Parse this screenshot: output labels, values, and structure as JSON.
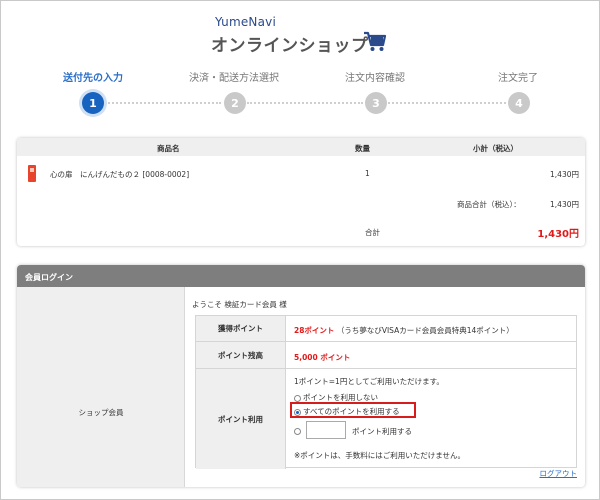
{
  "logo": {
    "top_text": "YumeNavi",
    "main_text": "オンラインショップ"
  },
  "steps": [
    {
      "number": "1",
      "label": "送付先の入力"
    },
    {
      "number": "2",
      "label": "決済・配送方法選択"
    },
    {
      "number": "3",
      "label": "注文内容確認"
    },
    {
      "number": "4",
      "label": "注文完了"
    }
  ],
  "cart": {
    "headers": {
      "product": "商品名",
      "quantity": "数量",
      "subtotal": "小計（税込）"
    },
    "item": {
      "name": "心の扉　にんげんだもの２ [0008-0002]",
      "quantity": "1",
      "price": "1,430円"
    },
    "product_total_label": "商品合計（税込）：",
    "product_total_value": "1,430円",
    "total_label": "合計",
    "total_value": "1,430円"
  },
  "member": {
    "section_title": "会員ログイン",
    "left_label": "ショップ会員",
    "welcome": "ようこそ 検証カード会員 様",
    "earned_label": "獲得ポイント",
    "earned_value": "28ポイント",
    "earned_note": "（うち夢なびVISAカード会員会員特典14ポイント）",
    "balance_label": "ポイント残高",
    "balance_value": "5,000 ポイント",
    "usage_label": "ポイント利用",
    "usage_rate": "1ポイント=1円としてご利用いただけます。",
    "option_none": "ポイントを利用しない",
    "option_all": "すべてのポイントを利用する",
    "option_partial_suffix": "ポイント利用する",
    "usage_note": "※ポイントは、手数料にはご利用いただけません。",
    "partial_value": "",
    "logout": "ログアウト"
  },
  "colors": {
    "accent": "#1763bf",
    "price_red": "#e01a1a",
    "highlight": "#d81b1b"
  }
}
